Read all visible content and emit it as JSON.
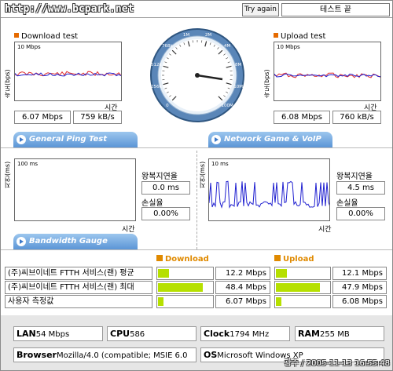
{
  "header": {
    "site_url": "http://www.bcpark.net",
    "try_again_label": "Try again",
    "status_text": "테스트 끝"
  },
  "download": {
    "title": "Download test",
    "y_axis_label": "속도(bps)",
    "scale_label": "10 Mbps",
    "x_axis_label": "시간",
    "mbps_value": "6.07 Mbps",
    "kbs_value": "759 kB/s"
  },
  "upload": {
    "title": "Upload test",
    "y_axis_label": "속도(bps)",
    "scale_label": "10 Mbps",
    "x_axis_label": "시간",
    "mbps_value": "6.08 Mbps",
    "kbs_value": "760 kB/s"
  },
  "speedometer": {
    "tick_labels": [
      "0",
      "256k",
      "512k",
      "768k",
      "1M",
      "2M",
      "4M",
      "8M",
      "10M",
      "100M"
    ],
    "needle_value": "6.07 Mbps"
  },
  "tabs": {
    "ping": "General Ping Test",
    "game": "Network Game & VoIP Test",
    "bandwidth": "Bandwidth Gauge"
  },
  "ping": {
    "y_axis_label": "지연(ms)",
    "scale_label": "100 ms",
    "x_axis_label": "시간",
    "rtt_label": "왕복지연율",
    "rtt_value": "0.0 ms",
    "loss_label": "손실율",
    "loss_value": "0.00%"
  },
  "game": {
    "y_axis_label": "지연(ms)",
    "scale_label": "10 ms",
    "x_axis_label": "시간",
    "rtt_label": "왕복지연율",
    "rtt_value": "4.5 ms",
    "loss_label": "손실율",
    "loss_value": "0.00%"
  },
  "gauge": {
    "download_label": "Download",
    "upload_label": "Upload",
    "rows": [
      {
        "name": "(주)씨브이네트 FTTH 서비스(랜) 평균",
        "down_value": "12.2 Mbps",
        "down_fraction": 0.21,
        "up_value": "12.1 Mbps",
        "up_fraction": 0.21
      },
      {
        "name": "(주)씨브이네트 FTTH 서비스(랜) 최대",
        "down_value": "48.4 Mbps",
        "down_fraction": 0.83,
        "up_value": "47.9 Mbps",
        "up_fraction": 0.82
      },
      {
        "name": "사용자 측정값",
        "down_value": "6.07 Mbps",
        "down_fraction": 0.1,
        "up_value": "6.08 Mbps",
        "up_fraction": 0.1
      }
    ]
  },
  "system": {
    "lan_key": "LAN",
    "lan_value": "54 Mbps",
    "cpu_key": "CPU",
    "cpu_value": "586",
    "clock_key": "Clock",
    "clock_value": "1794 MHz",
    "ram_key": "RAM",
    "ram_value": "255 MB",
    "browser_key": "Browser",
    "browser_value": "Mozilla/4.0 (compatible; MSIE 6.0",
    "os_key": "OS",
    "os_value": "Microsoft Windows XP"
  },
  "footer": {
    "timestamp": "광주 / 2005-11-13 16:55:48"
  },
  "colors": {
    "tab_blue": "#5b95d6",
    "bar_green": "#b6e000",
    "accent_orange": "#e08a00",
    "speed_line_blue": "#2020d0",
    "speed_line_red": "#e03030"
  }
}
